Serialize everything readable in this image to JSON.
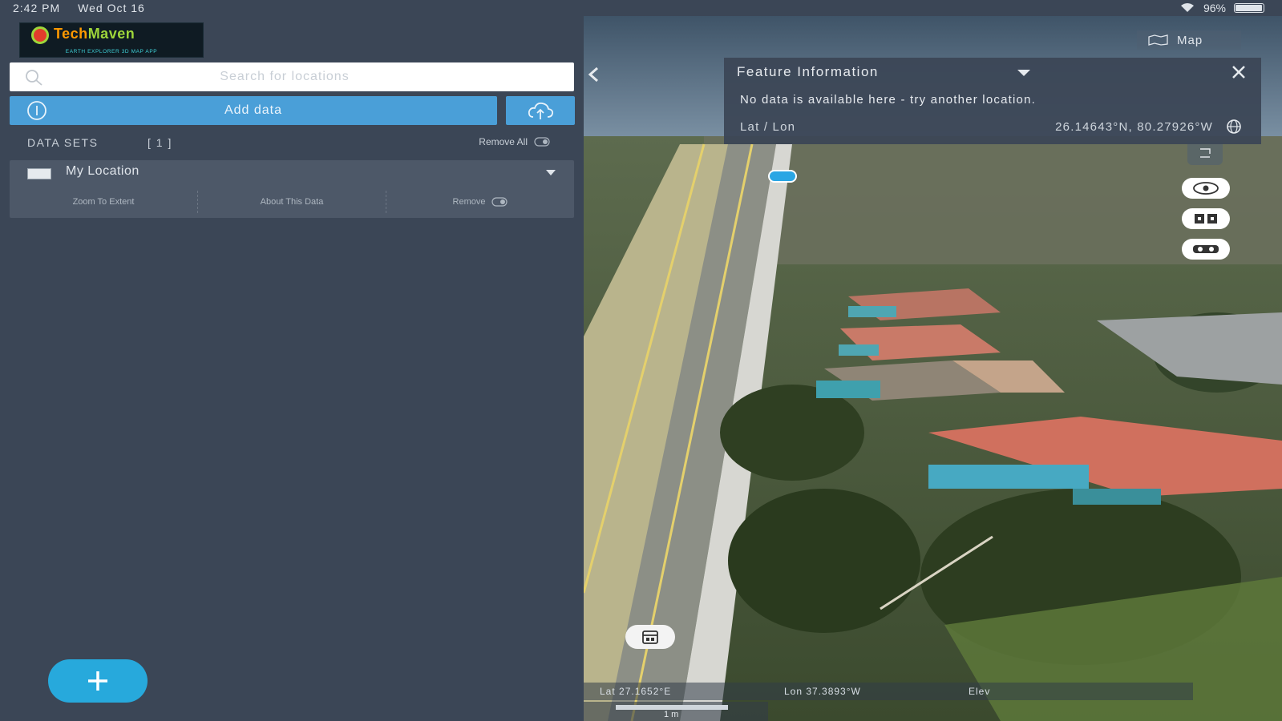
{
  "status_bar": {
    "time": "2:42 PM",
    "date": "Wed Oct 16",
    "battery": "96%"
  },
  "logo": {
    "title_part1": "Tech",
    "title_part2": "Maven",
    "subtitle": "EARTH EXPLORER 3D MAP APP"
  },
  "search": {
    "placeholder": "Search for locations",
    "value": ""
  },
  "add_data": {
    "label": "Add data"
  },
  "datasets": {
    "title": "DATA SETS",
    "count": "[ 1 ]",
    "remove_all_label": "Remove All",
    "items": [
      {
        "name": "My Location",
        "actions": {
          "zoom": "Zoom To Extent",
          "about": "About This Data",
          "remove": "Remove"
        }
      }
    ]
  },
  "map": {
    "toggle_label": "Map",
    "feature_info": {
      "title": "Feature Information",
      "message": "No data is available here - try another location.",
      "latlon_label": "Lat / Lon",
      "latlon_value": "26.14643°N, 80.27926°W"
    },
    "coord_bar": {
      "lat": "Lat  27.1652°E",
      "lon": "Lon  37.3893°W",
      "elev": "Elev"
    },
    "scale_label": "1 m"
  },
  "colors": {
    "panel": "#3b4656",
    "accent": "#4a9fd8",
    "fab": "#27a9dc"
  }
}
